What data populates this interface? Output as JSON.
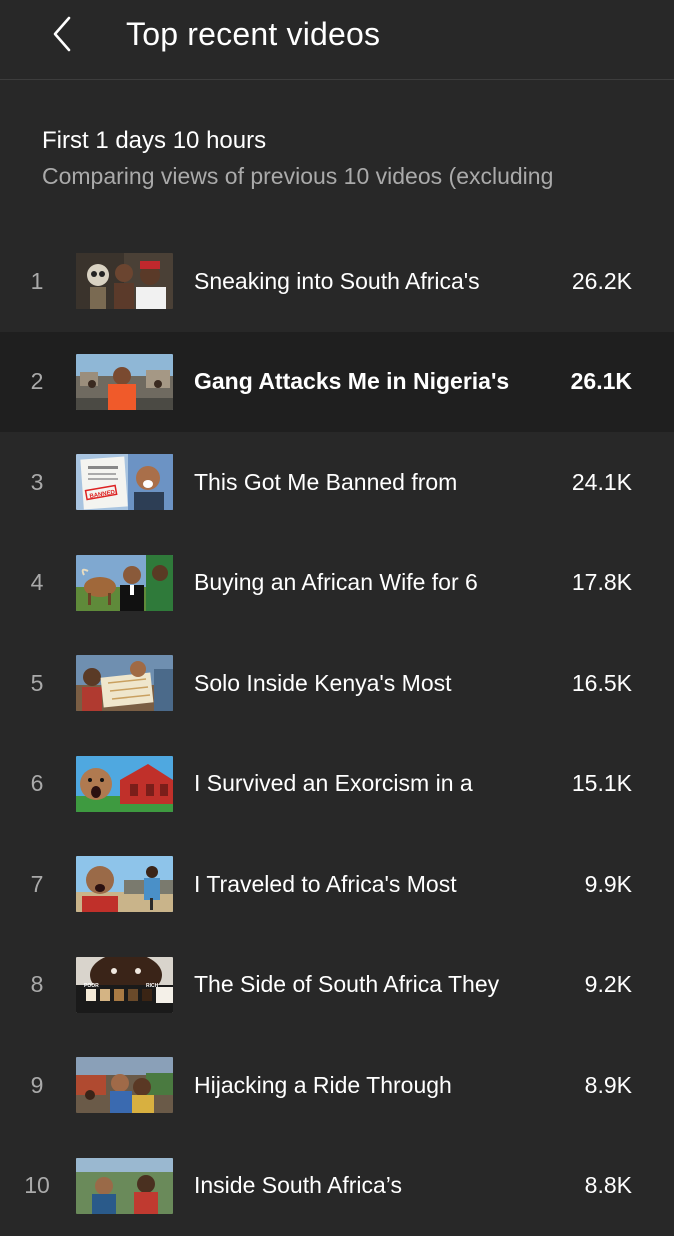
{
  "header": {
    "back_icon": "chevron-left-icon",
    "title": "Top recent videos"
  },
  "summary": {
    "period": "First 1 days 10 hours",
    "comparison": "Comparing views of previous 10 videos (excluding"
  },
  "videos": [
    {
      "rank": "1",
      "title": "Sneaking into South Africa's",
      "views": "26.2K",
      "selected": false
    },
    {
      "rank": "2",
      "title": "Gang Attacks Me in Nigeria's",
      "views": "26.1K",
      "selected": true
    },
    {
      "rank": "3",
      "title": "This Got Me Banned from",
      "views": "24.1K",
      "selected": false
    },
    {
      "rank": "4",
      "title": "Buying an African Wife for 6",
      "views": "17.8K",
      "selected": false
    },
    {
      "rank": "5",
      "title": "Solo Inside Kenya's Most",
      "views": "16.5K",
      "selected": false
    },
    {
      "rank": "6",
      "title": "I Survived an Exorcism in a",
      "views": "15.1K",
      "selected": false
    },
    {
      "rank": "7",
      "title": "I Traveled to Africa's Most",
      "views": "9.9K",
      "selected": false
    },
    {
      "rank": "8",
      "title": "The Side of South Africa They",
      "views": "9.2K",
      "selected": false
    },
    {
      "rank": "9",
      "title": "Hijacking a Ride Through",
      "views": "8.9K",
      "selected": false
    },
    {
      "rank": "10",
      "title": "Inside South Africa’s",
      "views": "8.8K",
      "selected": false
    }
  ],
  "thumbnail_text": {
    "banned_stamp": "BANNED",
    "poor_label": "POOR",
    "rich_label": "RICH"
  },
  "colors": {
    "background": "#282828",
    "selected_row": "#1f1f1f",
    "secondary_text": "#aaaaaa",
    "primary_text": "#ffffff"
  }
}
